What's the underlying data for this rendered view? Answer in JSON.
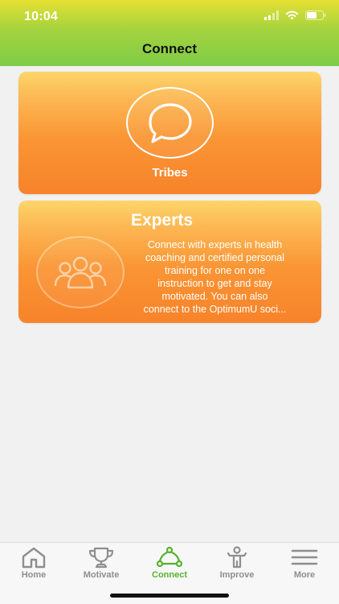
{
  "status_bar": {
    "time": "10:04",
    "icons": [
      "signal-icon",
      "wifi-icon",
      "battery-icon"
    ]
  },
  "nav": {
    "title": "Connect"
  },
  "cards": {
    "tribes": {
      "label": "Tribes",
      "icon": "chat-bubble-icon"
    },
    "experts": {
      "title": "Experts",
      "icon": "group-people-icon",
      "description": "Connect with experts in health\ncoaching and certified personal\ntraining for one on one\ninstruction to get and stay\nmotivated.  You can also\nconnect to the OptimumU soci..."
    }
  },
  "tabs": [
    {
      "label": "Home",
      "icon": "home-icon",
      "active": false
    },
    {
      "label": "Motivate",
      "icon": "trophy-icon",
      "active": false
    },
    {
      "label": "Connect",
      "icon": "connect-network-icon",
      "active": true
    },
    {
      "label": "Improve",
      "icon": "person-improve-icon",
      "active": false
    },
    {
      "label": "More",
      "icon": "menu-icon",
      "active": false
    }
  ],
  "colors": {
    "active_tab": "#56b22e",
    "inactive_tab": "#8e8e8e",
    "card_orange": "#f7832a",
    "header_green": "#7fcc48"
  }
}
